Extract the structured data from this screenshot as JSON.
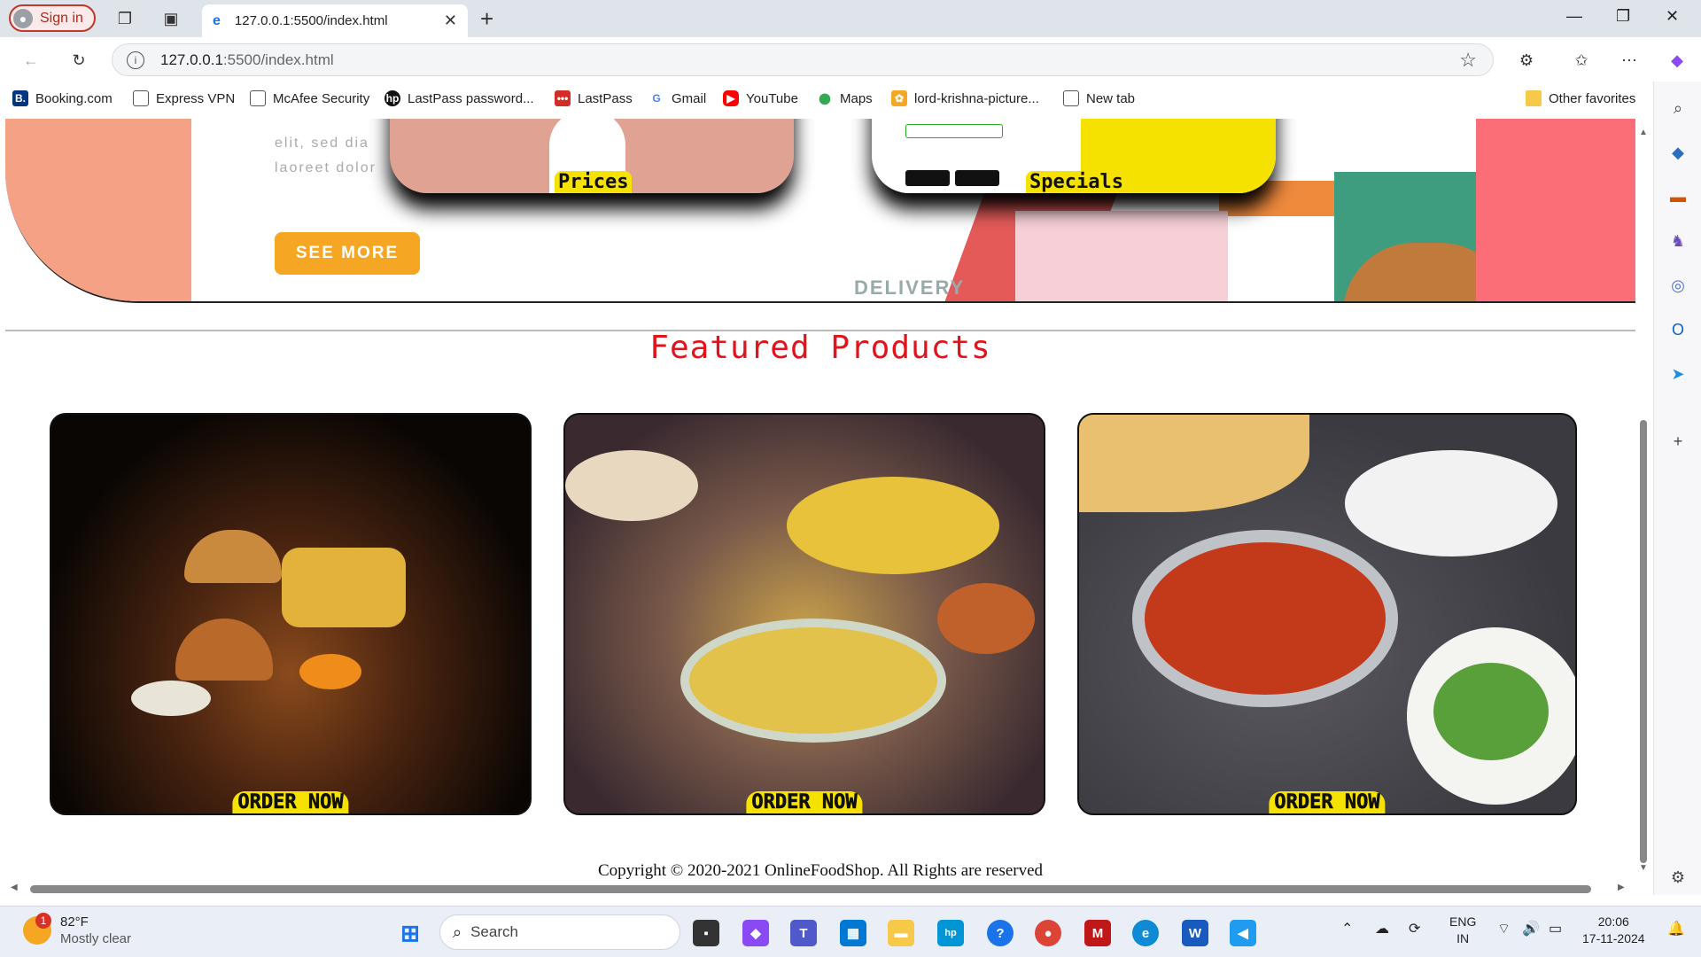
{
  "browser": {
    "signin_label": "Sign in",
    "tab_title": "127.0.0.1:5500/index.html",
    "url_host": "127.0.0.1",
    "url_path": ":5500/index.html",
    "bookmarks": [
      {
        "label": "Booking.com",
        "icon": "B.",
        "color": "#003580"
      },
      {
        "label": "Express VPN",
        "icon": "page-icon",
        "color": "#555"
      },
      {
        "label": "McAfee Security",
        "icon": "page-icon",
        "color": "#555"
      },
      {
        "label": "LastPass password...",
        "icon": "hp",
        "color": "#111"
      },
      {
        "label": "LastPass",
        "icon": "•••",
        "color": "#d32d27"
      },
      {
        "label": "Gmail",
        "icon": "G",
        "color": "#4285f4"
      },
      {
        "label": "YouTube",
        "icon": "▶",
        "color": "#ff0000"
      },
      {
        "label": "Maps",
        "icon": "📍",
        "color": "#34a853"
      },
      {
        "label": "lord-krishna-picture...",
        "icon": "✿",
        "color": "#f5a623"
      },
      {
        "label": "New tab",
        "icon": "▭",
        "color": "#555"
      }
    ],
    "other_favorites": "Other favorites"
  },
  "hero": {
    "body_text_line1": "elit, sed dia",
    "body_text_line2": "laoreet dolor",
    "see_more_label": "SEE MORE",
    "card_prices_label": "Prices",
    "card_specials_label": "Specials",
    "delivery_label": "DELIVERY"
  },
  "featured": {
    "title": "Featured Products",
    "products": [
      {
        "order_label": "ORDER NOW",
        "image": "burgers-and-fries-photo"
      },
      {
        "order_label": "ORDER NOW",
        "image": "biryani-platter-photo"
      },
      {
        "order_label": "ORDER NOW",
        "image": "curry-and-naan-photo"
      }
    ]
  },
  "footer": {
    "copyright": "Copyright © 2020-2021 OnlineFoodShop. All Rights are reserved"
  },
  "taskbar": {
    "weather_temp": "82°F",
    "weather_desc": "Mostly clear",
    "weather_badge": "1",
    "search_label": "Search",
    "lang_line1": "ENG",
    "lang_line2": "IN",
    "time": "20:06",
    "date": "17-11-2024"
  },
  "colors": {
    "accent_red": "#e0141a",
    "button_yellow": "#f6e200",
    "see_more_orange": "#f5a623"
  }
}
